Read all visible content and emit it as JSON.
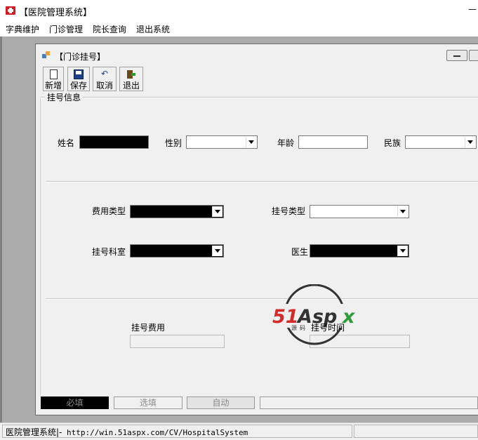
{
  "app": {
    "title": "【医院管理系统】",
    "icon": "red-cross-icon"
  },
  "menu": {
    "items": [
      "字典维护",
      "门诊管理",
      "院长查询",
      "退出系统"
    ]
  },
  "child_window": {
    "title": "【门诊挂号】",
    "toolbar": [
      {
        "label": "新增",
        "icon": "new-document-icon"
      },
      {
        "label": "保存",
        "icon": "save-disk-icon"
      },
      {
        "label": "取消",
        "icon": "undo-icon"
      },
      {
        "label": "退出",
        "icon": "exit-icon"
      }
    ],
    "group_title": "挂号信息",
    "form": {
      "name_label": "姓名",
      "gender_label": "性别",
      "age_label": "年龄",
      "ethnicity_label": "民族",
      "fee_type_label": "费用类型",
      "register_type_label": "挂号类型",
      "department_label": "挂号科室",
      "doctor_label": "医生",
      "fee_label": "挂号费用",
      "time_label": "挂号时间"
    },
    "legend": {
      "required": "必填",
      "optional": "选填",
      "auto": "自动"
    }
  },
  "watermark": {
    "brand": "51Aspx",
    "tagline": "源码下载"
  },
  "status": {
    "prefix": "医院管理系统|-",
    "url": " http://win.51aspx.com/CV/HospitalSystem"
  },
  "colors": {
    "required_fill": "#000000",
    "mdi_background": "#ababab",
    "logo_red": "#d42a2a",
    "logo_green": "#2f9a3a"
  }
}
